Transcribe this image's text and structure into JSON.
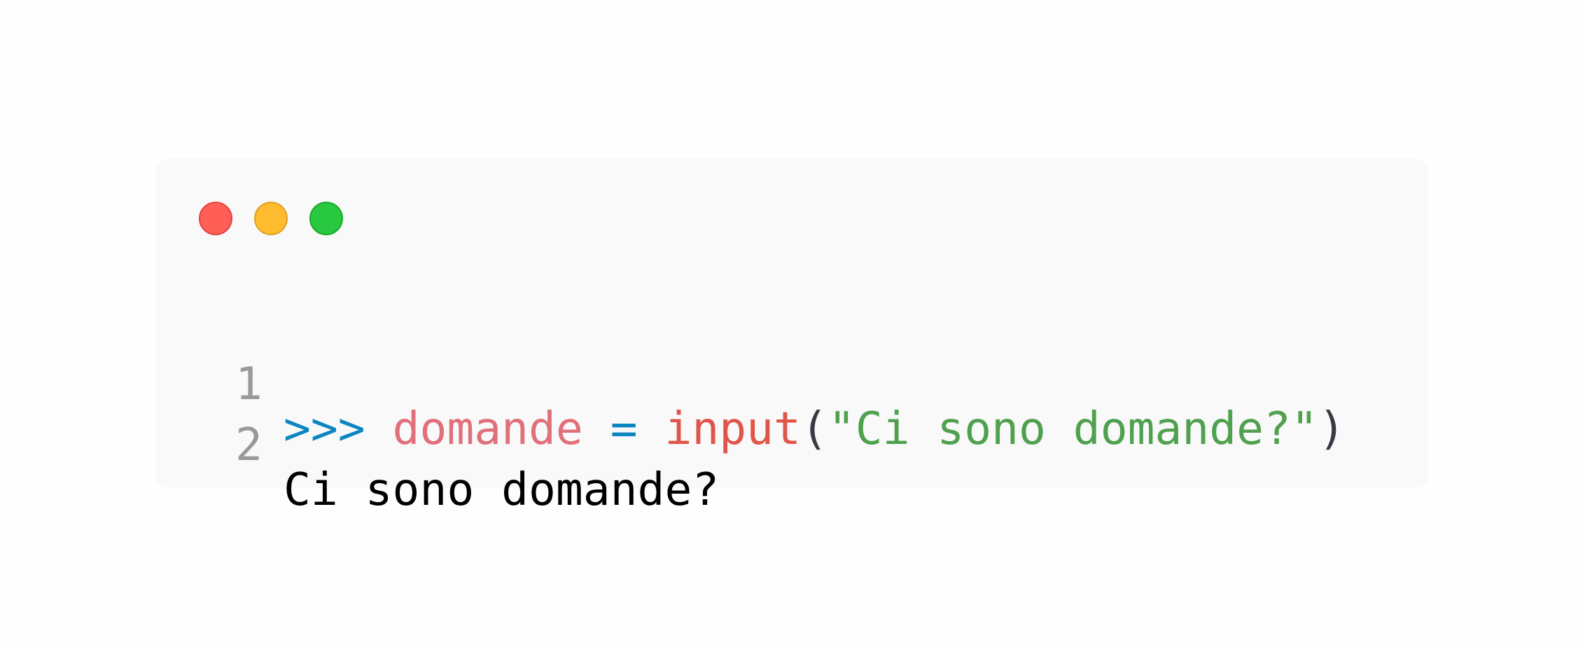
{
  "window_controls": {
    "close_color": "#ff5f57",
    "minimize_color": "#febc2e",
    "maximize_color": "#28c840"
  },
  "lines": [
    {
      "number": "1",
      "prompt": ">>>",
      "variable": "domande",
      "operator": "=",
      "function": "input",
      "open_paren": "(",
      "string": "\"Ci sono domande?\"",
      "close_paren": ")"
    },
    {
      "number": "2",
      "output": "Ci sono domande?"
    }
  ]
}
